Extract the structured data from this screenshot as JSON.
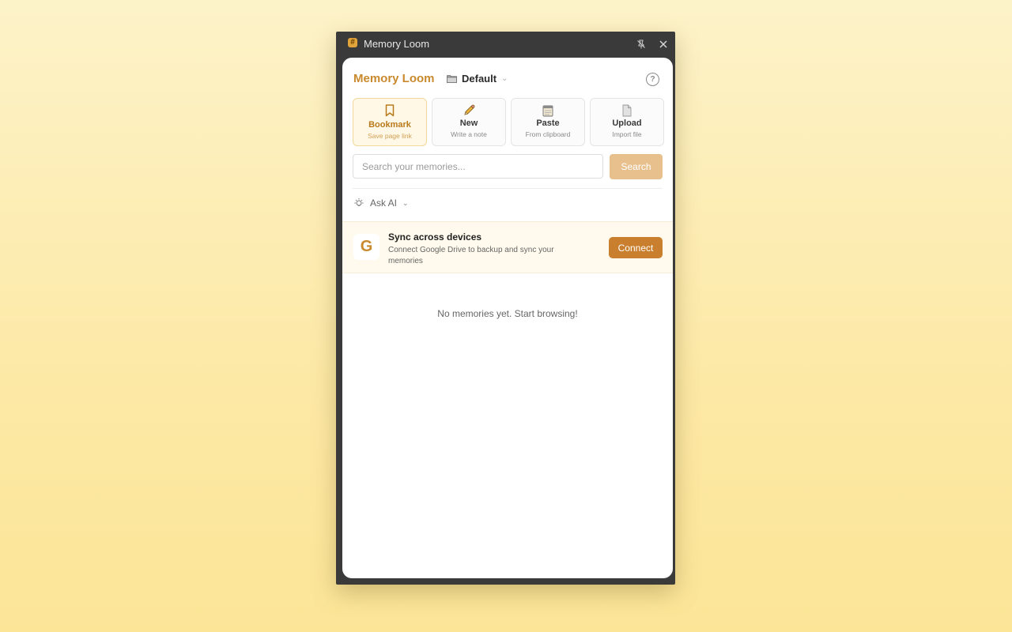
{
  "window": {
    "title": "Memory Loom"
  },
  "header": {
    "brand": "Memory Loom",
    "collection": "Default"
  },
  "actions": [
    {
      "title": "Bookmark",
      "subtitle": "Save page link",
      "icon": "bookmark-icon"
    },
    {
      "title": "New",
      "subtitle": "Write a note",
      "icon": "pencil-icon"
    },
    {
      "title": "Paste",
      "subtitle": "From clipboard",
      "icon": "clipboard-icon"
    },
    {
      "title": "Upload",
      "subtitle": "Import file",
      "icon": "file-icon"
    }
  ],
  "search": {
    "placeholder": "Search your memories...",
    "value": "",
    "button": "Search"
  },
  "ask_ai": {
    "label": "Ask AI"
  },
  "sync": {
    "title": "Sync across devices",
    "description": "Connect Google Drive to backup and sync your memories",
    "button": "Connect",
    "logo": "G"
  },
  "empty_state": "No memories yet. Start browsing!",
  "colors": {
    "accent": "#c98a2e",
    "connect": "#c97f2d",
    "search_button": "#e8c08e",
    "background": "#fde9a6"
  }
}
